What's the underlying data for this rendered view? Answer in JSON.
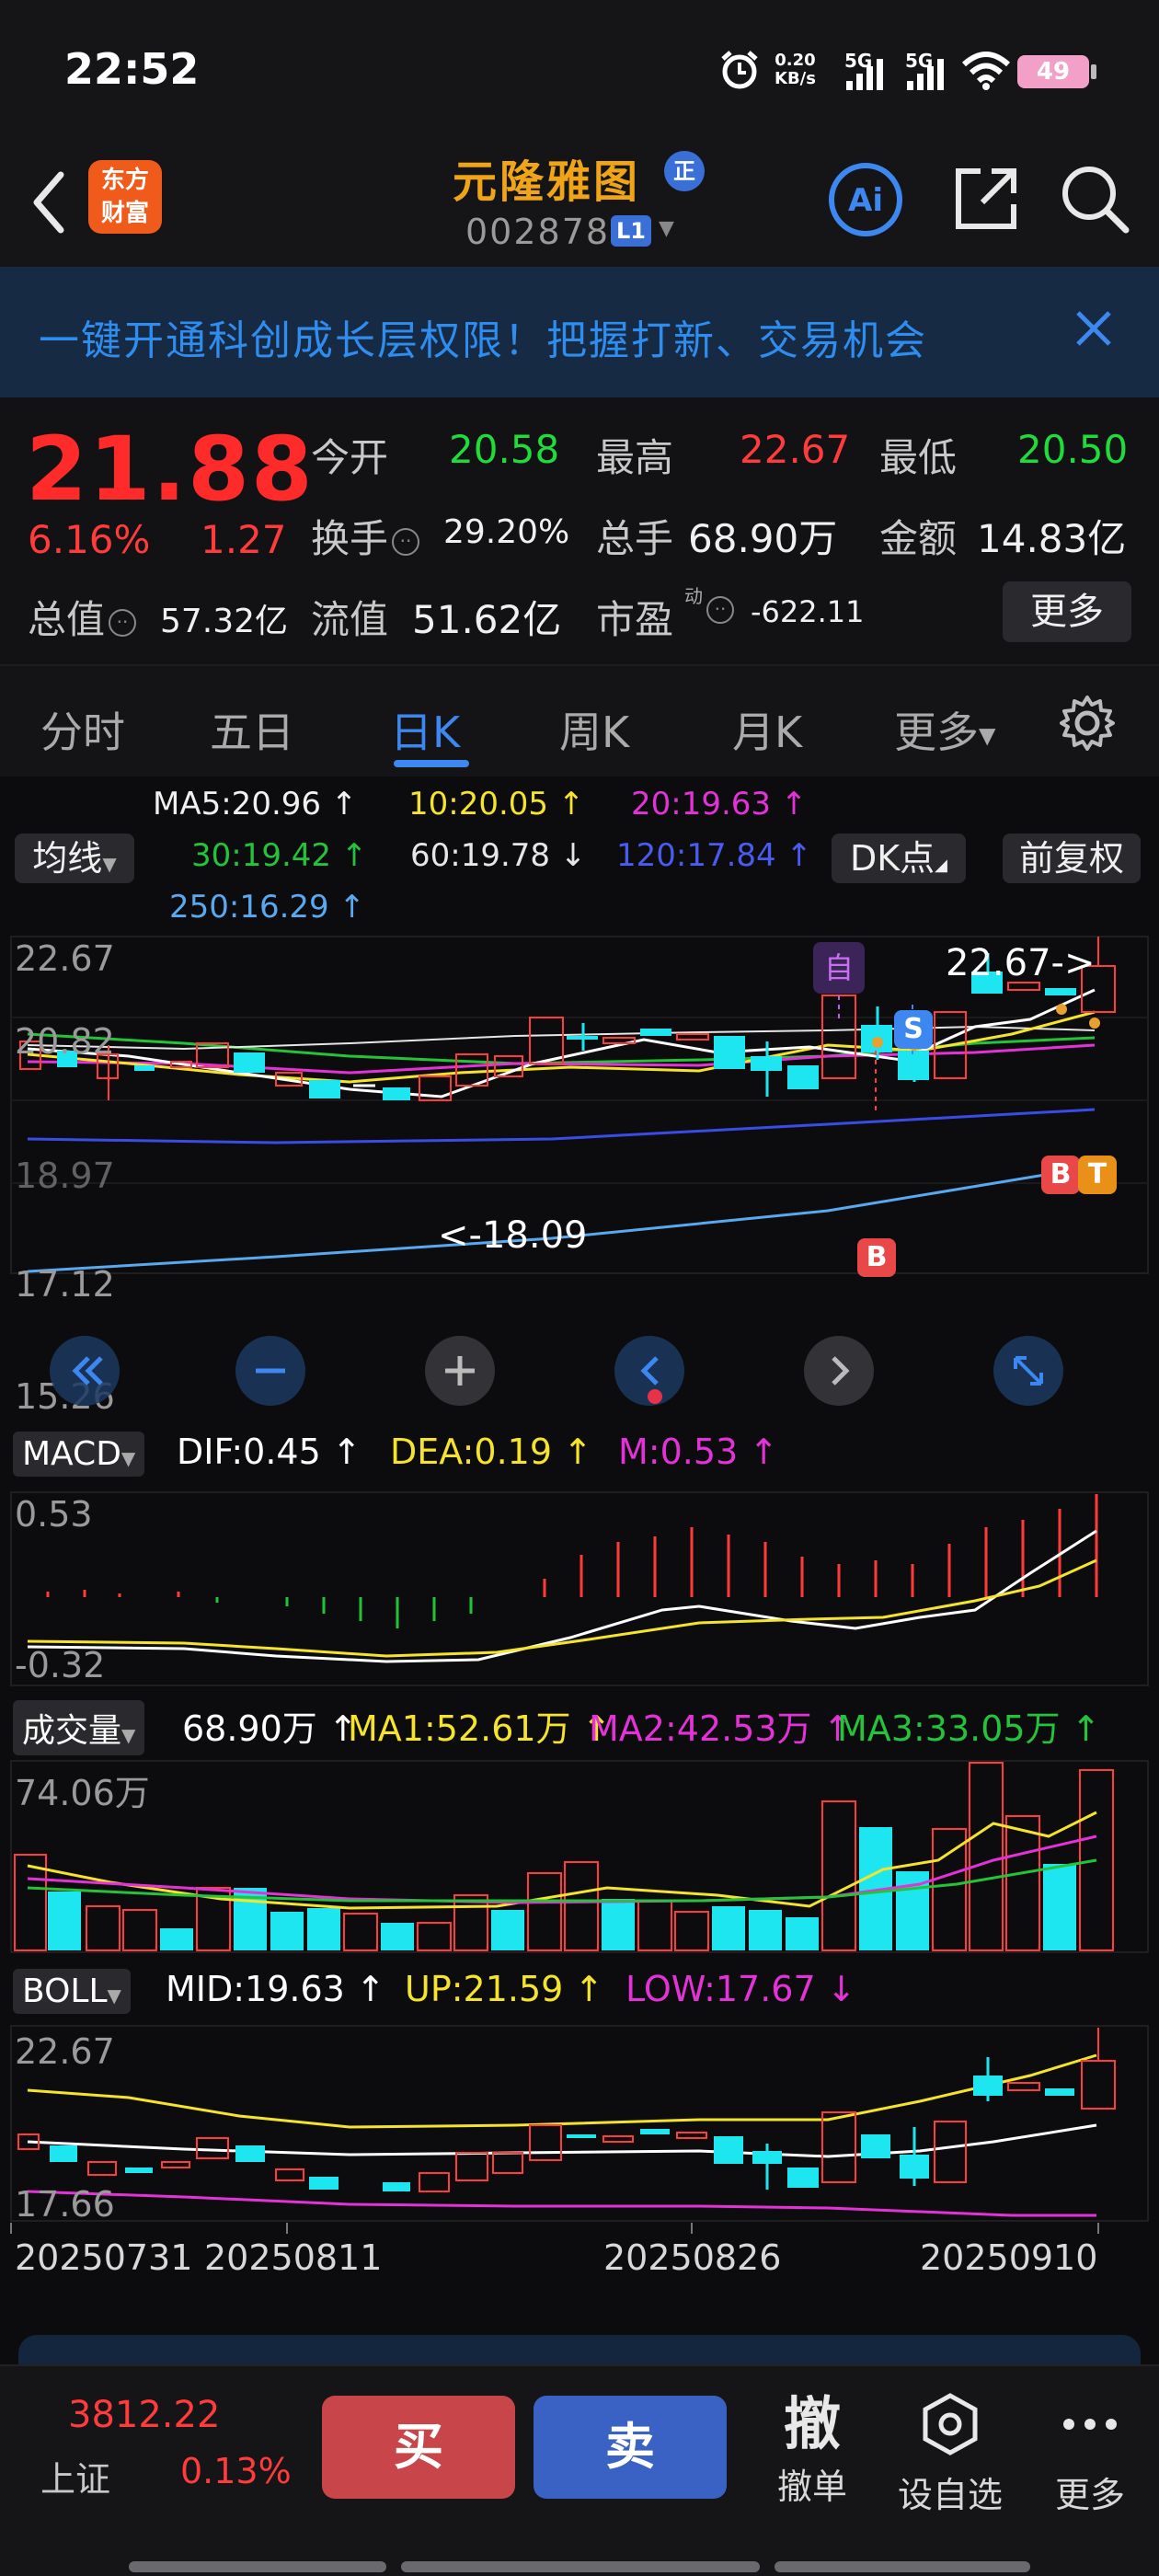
{
  "status_bar": {
    "time": "22:52",
    "net_speed_value": "0.20",
    "net_speed_unit": "KB/s",
    "network_1": "5G",
    "network_2": "5G",
    "battery": "49"
  },
  "header": {
    "logo_line1": "东方",
    "logo_line2": "财富",
    "stock_name": "元隆雅图",
    "badge": "正",
    "stock_code": "002878",
    "level_badge": "L1",
    "ai_label": "Ai"
  },
  "banner": {
    "text": "一键开通科创成长层权限！把握打新、交易机会"
  },
  "quote": {
    "price": "21.88",
    "change_pct": "6.16%",
    "change": "1.27",
    "open_label": "今开",
    "open": "20.58",
    "high_label": "最高",
    "high": "22.67",
    "low_label": "最低",
    "low": "20.50",
    "turnover_label": "换手",
    "turnover": "29.20%",
    "volume_label": "总手",
    "volume": "68.90万",
    "amount_label": "金额",
    "amount": "14.83亿",
    "mktcap_label": "总值",
    "mktcap": "57.32亿",
    "float_label": "流值",
    "float_cap": "51.62亿",
    "pe_label": "市盈",
    "pe_sup": "动",
    "pe": "-622.11",
    "more": "更多"
  },
  "tabs": [
    {
      "label": "分时"
    },
    {
      "label": "五日"
    },
    {
      "label": "日K"
    },
    {
      "label": "周K"
    },
    {
      "label": "月K"
    },
    {
      "label": "更多"
    }
  ],
  "ma_legend": {
    "selector": "均线",
    "ma5": "MA5:20.96 ↑",
    "ma10": "10:20.05 ↑",
    "ma20": "20:19.63 ↑",
    "ma30": "30:19.42 ↑",
    "ma60": "60:19.78 ↓",
    "ma120": "120:17.84 ↑",
    "ma250": "250:16.29 ↑",
    "dk_button": "DK点",
    "adjust_button": "前复权"
  },
  "main_chart": {
    "y_labels": [
      "22.67",
      "20.82",
      "18.97",
      "17.12",
      "15.26"
    ],
    "max_marker": "22.67->",
    "min_marker": "<-18.09",
    "zi_marker": "自",
    "s_marker": "S",
    "b_marker": "B",
    "b_marker2": "B",
    "t_marker": "T"
  },
  "macd": {
    "selector": "MACD",
    "dif": "DIF:0.45 ↑",
    "dea": "DEA:0.19 ↑",
    "m": "M:0.53 ↑",
    "y_top": "0.53",
    "y_bottom": "-0.32"
  },
  "volume": {
    "selector": "成交量",
    "value": "68.90万 ↑",
    "ma1": "MA1:52.61万 ↑",
    "ma2": "MA2:42.53万 ↑",
    "ma3": "MA3:33.05万 ↑",
    "y_top": "74.06万"
  },
  "boll": {
    "selector": "BOLL",
    "mid": "MID:19.63 ↑",
    "up": "UP:21.59 ↑",
    "low": "LOW:17.67 ↓",
    "y_top": "22.67",
    "y_bottom": "17.66"
  },
  "dates": [
    "20250731",
    "20250811",
    "20250826",
    "20250910"
  ],
  "bottom_bar": {
    "index_value": "3812.22",
    "index_name": "上证",
    "index_pct": "0.13%",
    "buy": "买",
    "sell": "卖",
    "cancel_icon": "撤",
    "cancel": "撤单",
    "watchlist": "设自选",
    "more": "更多"
  },
  "colors": {
    "up": "#ff3b3b",
    "down": "#1fdc3a",
    "accent": "#3d87f0",
    "brand": "#f0a418"
  }
}
